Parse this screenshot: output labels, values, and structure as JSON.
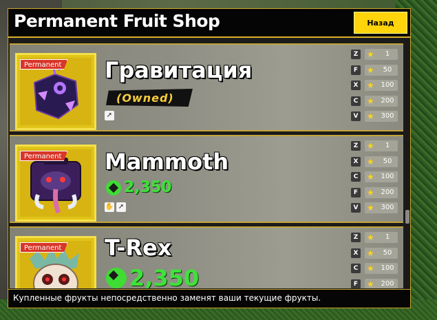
{
  "shop": {
    "title": "Permanent Fruit Shop",
    "back_label": "Назад",
    "footer_note": "Купленные фрукты непосредственно заменят ваши текущие фрукты."
  },
  "fruits": [
    {
      "badge": "Permanent",
      "name": "Гравитация",
      "owned_label": "(Owned)",
      "icon": "gravity-fruit-icon",
      "type_icons": [
        "move-icon"
      ],
      "moves": [
        {
          "key": "Z",
          "level": "1"
        },
        {
          "key": "F",
          "level": "50"
        },
        {
          "key": "X",
          "level": "100"
        },
        {
          "key": "C",
          "level": "200"
        },
        {
          "key": "V",
          "level": "300"
        }
      ]
    },
    {
      "badge": "Permanent",
      "name": "Mammoth",
      "price": "2,350",
      "icon": "mammoth-fruit-icon",
      "type_icons": [
        "claw-icon",
        "move-icon"
      ],
      "moves": [
        {
          "key": "Z",
          "level": "1"
        },
        {
          "key": "X",
          "level": "50"
        },
        {
          "key": "C",
          "level": "100"
        },
        {
          "key": "F",
          "level": "200"
        },
        {
          "key": "V",
          "level": "300"
        }
      ]
    },
    {
      "badge": "Permanent",
      "name": "T-Rex",
      "price": "2,350",
      "icon": "t-rex-fruit-icon",
      "moves": [
        {
          "key": "Z",
          "level": "1"
        },
        {
          "key": "X",
          "level": "50"
        },
        {
          "key": "C",
          "level": "100"
        },
        {
          "key": "F",
          "level": "200"
        }
      ]
    }
  ],
  "colors": {
    "gold": "#d9b22e",
    "robux_green": "#3fe23a",
    "badge_red": "#d8362a",
    "back_yellow": "#ffd40a"
  }
}
